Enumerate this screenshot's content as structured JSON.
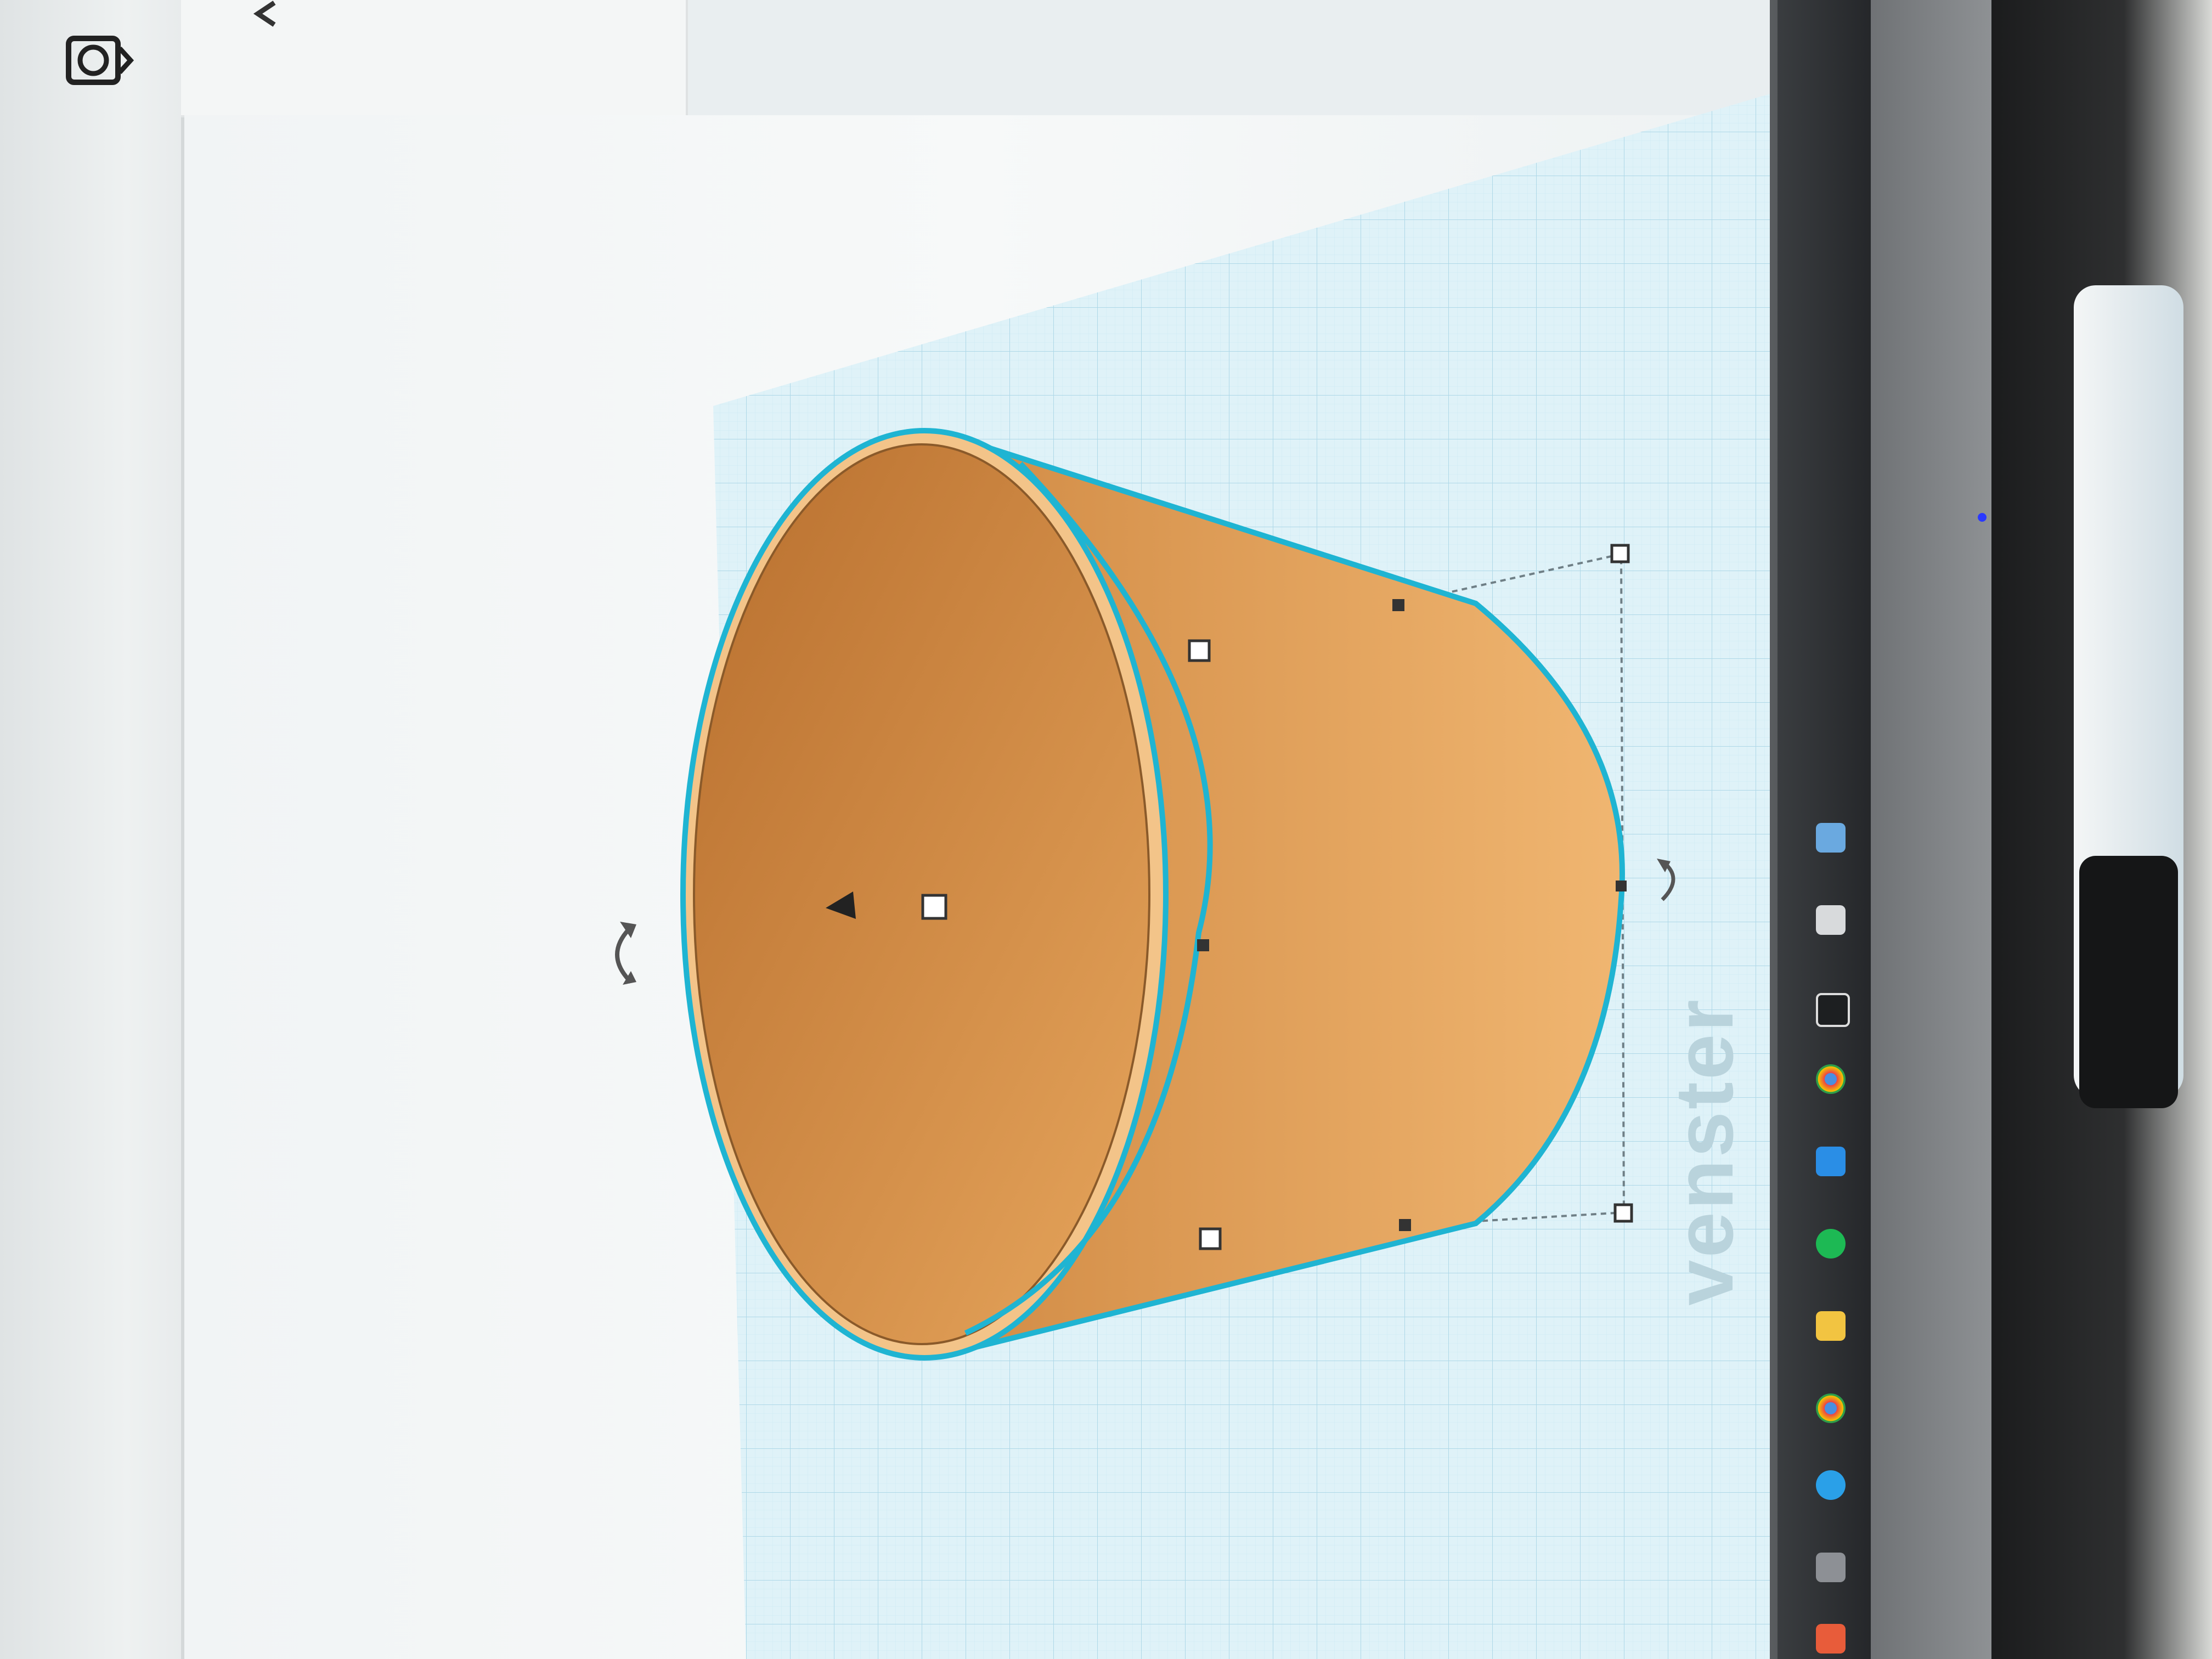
{
  "workspace": {
    "watermark_text": "venster",
    "colors": {
      "shape_fill": "#e4a358",
      "shape_outline": "#1fb4d2",
      "workplane_grid": "#bfe3ef",
      "background": "#f3f6f6"
    }
  },
  "left_toolbar": {
    "icon": "camera-view-icon"
  },
  "selected_shape": {
    "type": "tapered cylinder / cup",
    "handles": [
      "top-handle",
      "mid-handle",
      "bottom-handle",
      "corner-top-right",
      "corner-bottom-right"
    ],
    "rotate_icons": [
      "rotate-left-icon",
      "rotate-right-icon"
    ]
  },
  "taskbar": {
    "icons": [
      "windows-start-icon",
      "chrome-icon",
      "edge-icon",
      "explorer-icon",
      "spotify-icon",
      "outlook-icon",
      "chrome-icon-2",
      "app-icon",
      "teams-icon",
      "edge-icon-2"
    ]
  }
}
